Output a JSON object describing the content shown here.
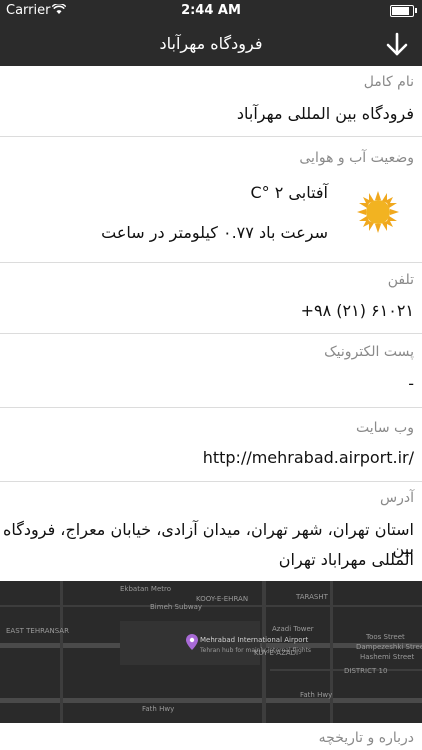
{
  "status": {
    "carrier": "Carrier",
    "time": "2:44 AM",
    "battery_level": 0.9
  },
  "nav": {
    "title": "فرودگاه مهرآباد",
    "download_icon": "download-icon"
  },
  "sections": {
    "full_name": {
      "label": "نام کامل",
      "value": "فرودگاه بین المللی مهرآباد"
    },
    "weather": {
      "label": "وضعیت آب و هوایی",
      "condition": "آفتابی C° ۲",
      "wind": "سرعت باد ۰.۷۷ کیلومتر در ساعت",
      "icon": "sun-icon"
    },
    "phone": {
      "label": "تلفن",
      "value": "+۹۸ (۲۱) ۶۱۰۲۱"
    },
    "email": {
      "label": "پست الکترونیک",
      "value": "-"
    },
    "website": {
      "label": "وب سایت",
      "value": "http://mehrabad.airport.ir/"
    },
    "address": {
      "label": "آدرس",
      "line1": "استان تهران، شهر تهران، میدان آزادی، خیابان معراج، فرودگاه بین",
      "line2": "المللی مهراباد تهران"
    },
    "about": {
      "label": "درباره و تاریخچه"
    }
  },
  "map": {
    "pin_title": "Mehrabad International Airport",
    "pin_sub": "Tehran hub for mainly internal flights",
    "labels": [
      "Ekbatan Metro",
      "Bimeh Subway",
      "Azadi Tower",
      "KOOY-E-EHRAN",
      "EAST TEHRANSAR",
      "DISTRICT 10",
      "Fath Hwy",
      "Fath Hwy",
      "Dampezeshki Street",
      "Hashemi Street",
      "Toos Street",
      "TARASHT",
      "KUY-E-AZADI"
    ]
  }
}
